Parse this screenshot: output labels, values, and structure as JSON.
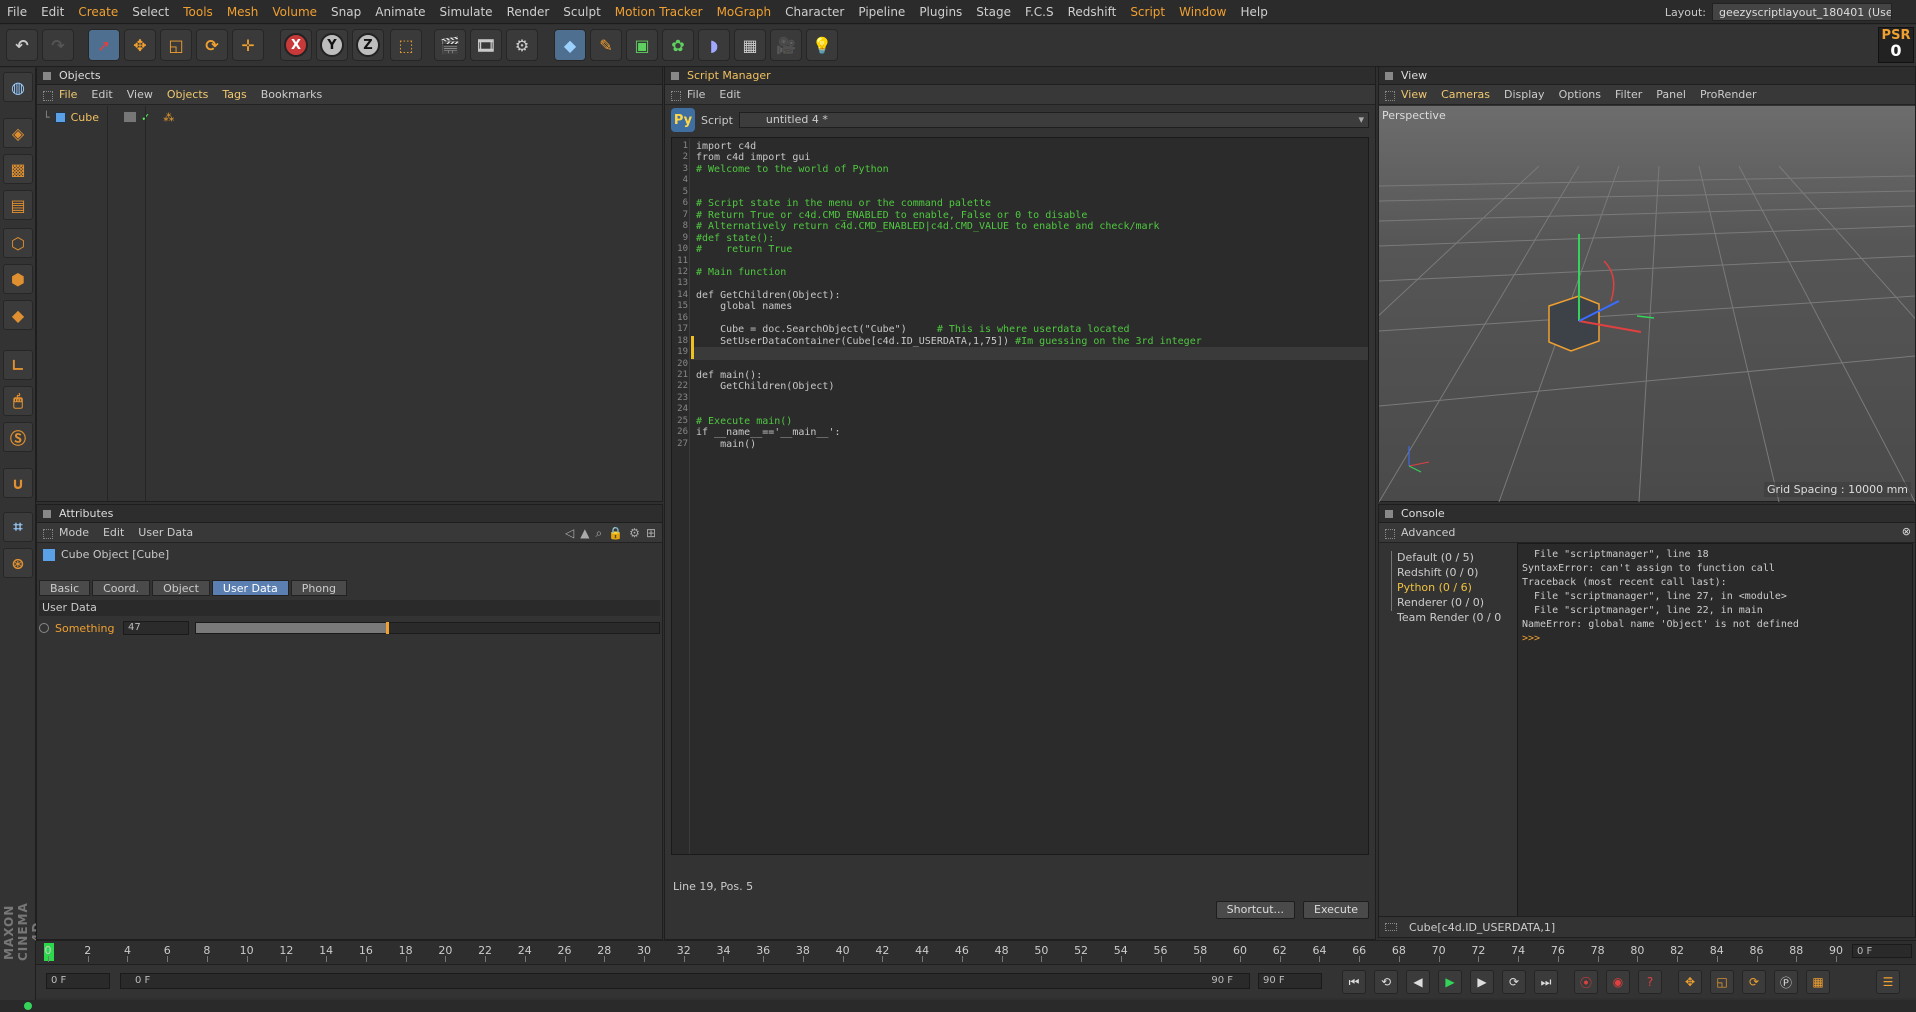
{
  "menubar": {
    "items": [
      "File",
      "Edit",
      "Create",
      "Select",
      "Tools",
      "Mesh",
      "Volume",
      "Snap",
      "Animate",
      "Simulate",
      "Render",
      "Sculpt",
      "Motion Tracker",
      "MoGraph",
      "Character",
      "Pipeline",
      "Plugins",
      "Stage",
      "F.C.S",
      "Redshift",
      "Script",
      "Window",
      "Help"
    ],
    "highlight": [
      "Create",
      "Tools",
      "Mesh",
      "Volume",
      "Motion Tracker",
      "MoGraph",
      "Script",
      "Window"
    ],
    "layout_label": "Layout:",
    "layout_value": "geezyscriptlayout_180401 (User)"
  },
  "toolbar": {
    "x_label": "X",
    "y_label": "Y",
    "z_label": "Z",
    "psr_label": "PSR",
    "psr_value": "0"
  },
  "sidebar": {
    "brand": "MAXON CINEMA 4D"
  },
  "objects_panel": {
    "title": "Objects",
    "menu": [
      "File",
      "Edit",
      "View",
      "Objects",
      "Tags",
      "Bookmarks"
    ],
    "object_name": "Cube"
  },
  "attributes_panel": {
    "title": "Attributes",
    "menu": [
      "Mode",
      "Edit",
      "User Data"
    ],
    "object_title": "Cube Object [Cube]",
    "tabs": [
      "Basic",
      "Coord.",
      "Object",
      "User Data",
      "Phong"
    ],
    "active_tab": "User Data",
    "section": "User Data",
    "field_label": "Something",
    "field_value": "47",
    "slider_fraction": 0.41
  },
  "script_manager": {
    "title": "Script Manager",
    "menu": [
      "File",
      "Edit"
    ],
    "script_label": "Script",
    "script_name": "untitled 4 *",
    "current_line": 19,
    "status": "Line 19, Pos. 5",
    "shortcut_btn": "Shortcut...",
    "execute_btn": "Execute",
    "lines": [
      "import c4d",
      "from c4d import gui",
      "# Welcome to the world of Python",
      "",
      "",
      "# Script state in the menu or the command palette",
      "# Return True or c4d.CMD_ENABLED to enable, False or 0 to disable",
      "# Alternatively return c4d.CMD_ENABLED|c4d.CMD_VALUE to enable and check/mark",
      "#def state():",
      "#    return True",
      "",
      "# Main function",
      "",
      "def GetChildren(Object):",
      "    global names",
      "",
      "    Cube = doc.SearchObject(\"Cube\")     # This is where userdata located",
      "    SetUserDataContainer(Cube[c4d.ID_USERDATA,1,75]) #Im guessing on the 3rd integer",
      "    ",
      "",
      "def main():",
      "    GetChildren(Object)",
      "",
      "",
      "# Execute main()",
      "if __name__=='__main__':",
      "    main()"
    ]
  },
  "view_panel": {
    "title": "View",
    "menu": [
      "View",
      "Cameras",
      "Display",
      "Options",
      "Filter",
      "Panel",
      "ProRender"
    ],
    "camera": "Perspective",
    "grid_spacing": "Grid Spacing : 10000 mm"
  },
  "console_panel": {
    "title": "Console",
    "subtitle": "Advanced",
    "tree": [
      "Default (0 / 5)",
      "Redshift (0 / 0)",
      "Python (0 / 6)",
      "Renderer (0 / 0)",
      "Team Render  (0 / 0"
    ],
    "tree_active": "Python (0 / 6)",
    "output": [
      "  File \"scriptmanager\", line 18",
      "SyntaxError: can't assign to function call",
      "Traceback (most recent call last):",
      "  File \"scriptmanager\", line 27, in <module>",
      "  File \"scriptmanager\", line 22, in main",
      "NameError: global name 'Object' is not defined"
    ],
    "prompt": ">>>",
    "input": "Cube[c4d.ID_USERDATA,1]"
  },
  "timeline": {
    "ticks": [
      "0",
      "2",
      "4",
      "6",
      "8",
      "10",
      "12",
      "14",
      "16",
      "18",
      "20",
      "22",
      "24",
      "26",
      "28",
      "30",
      "32",
      "34",
      "36",
      "38",
      "40",
      "42",
      "44",
      "46",
      "48",
      "50",
      "52",
      "54",
      "56",
      "58",
      "60",
      "62",
      "64",
      "66",
      "68",
      "70",
      "72",
      "74",
      "76",
      "78",
      "80",
      "82",
      "84",
      "86",
      "88",
      "90"
    ],
    "end_field": "0 F"
  },
  "transport": {
    "start": "0 F",
    "range_start": "0 F",
    "range_end": "90 F",
    "end": "90 F"
  }
}
